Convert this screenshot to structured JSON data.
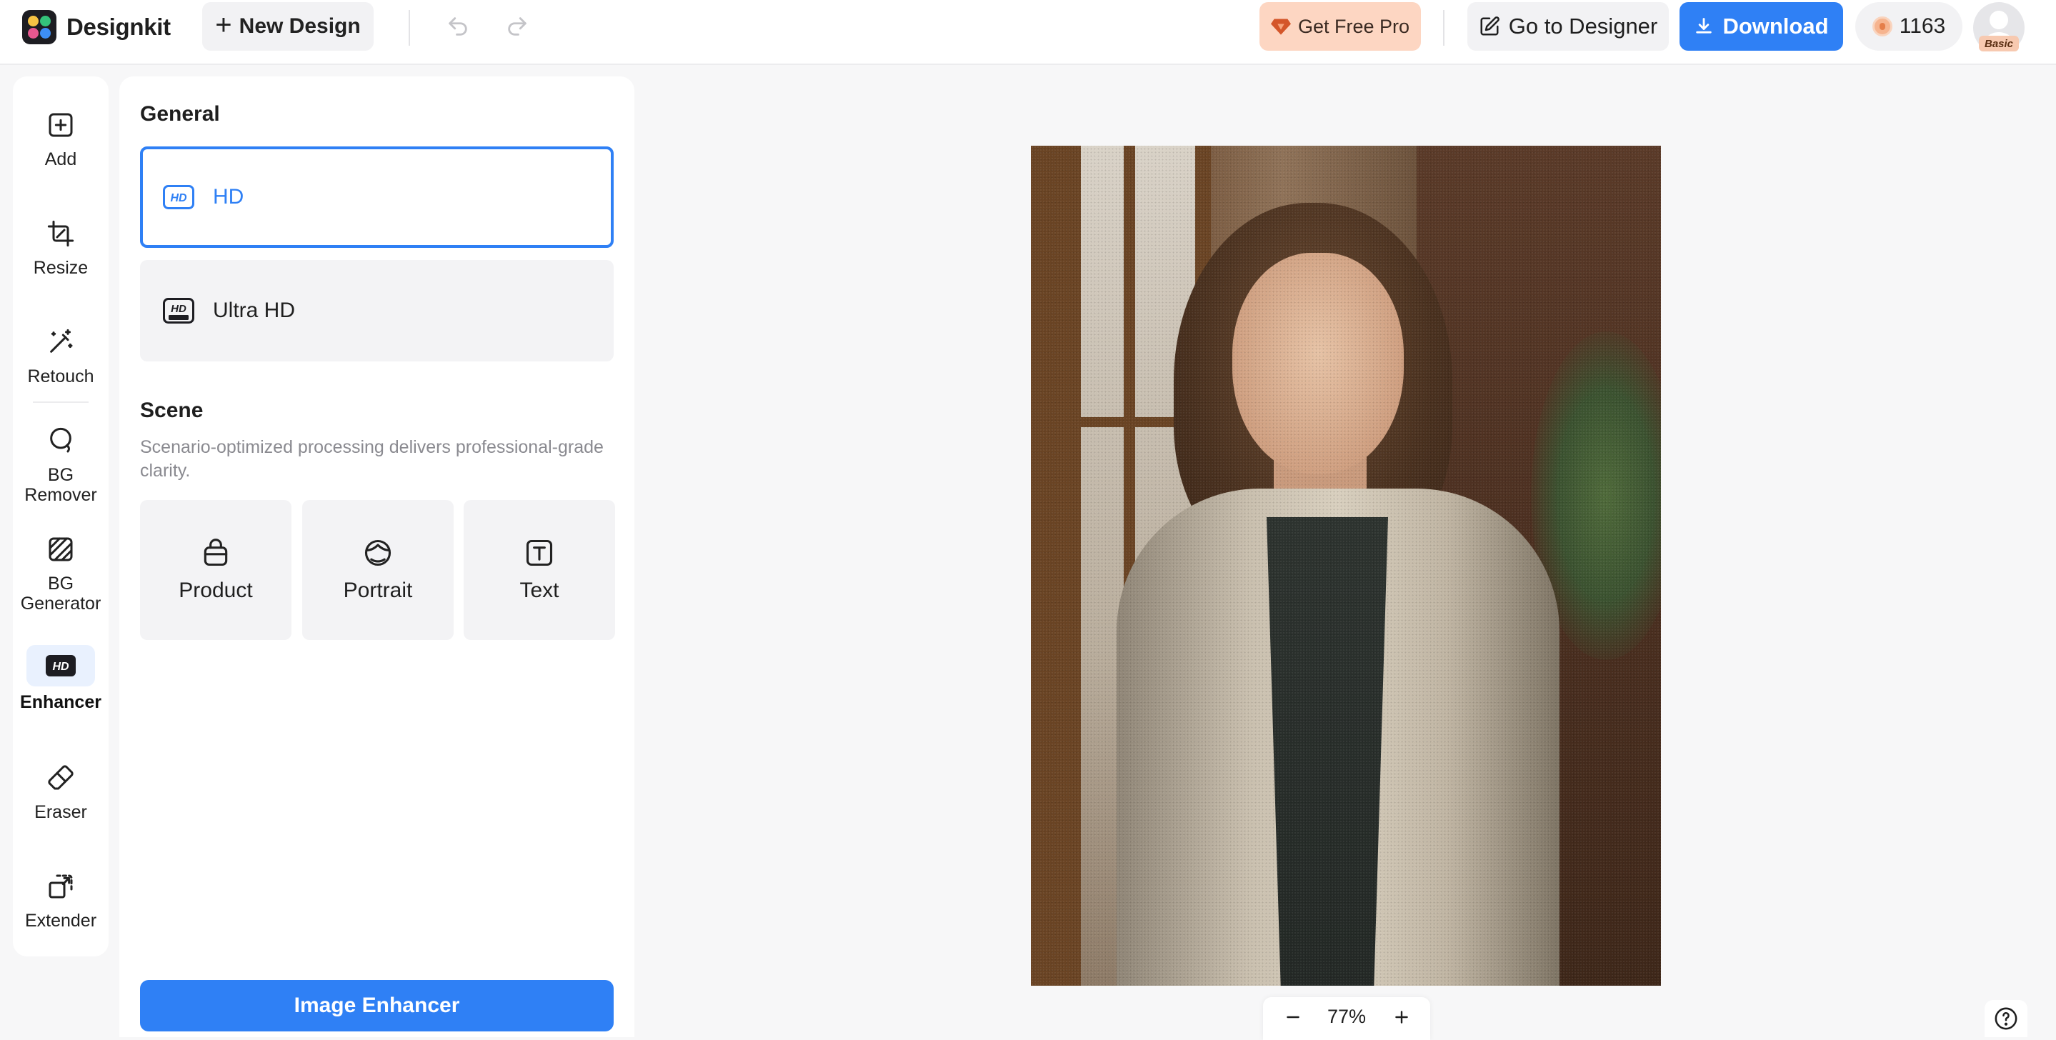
{
  "app": {
    "name": "Designkit"
  },
  "toolbar": {
    "new_design_label": "New Design",
    "get_pro_label": "Get Free Pro",
    "go_to_designer_label": "Go to Designer",
    "download_label": "Download",
    "credits": "1163",
    "plan_badge": "Basic"
  },
  "tools": [
    {
      "label": "Add",
      "icon": "add-square-icon"
    },
    {
      "label": "Resize",
      "icon": "crop-icon"
    },
    {
      "label": "Retouch",
      "icon": "magic-wand-icon"
    },
    {
      "label": "BG\nRemover",
      "icon": "lasso-icon"
    },
    {
      "label": "BG\nGenerator",
      "icon": "hatched-square-icon"
    },
    {
      "label": "Enhancer",
      "icon": "hd-icon",
      "active": true
    },
    {
      "label": "Eraser",
      "icon": "eraser-icon"
    },
    {
      "label": "Extender",
      "icon": "expand-icon"
    }
  ],
  "panel": {
    "general_title": "General",
    "options": [
      {
        "label": "HD",
        "icon": "hd-icon",
        "selected": true
      },
      {
        "label": "Ultra HD",
        "icon": "hd-ultra-icon",
        "selected": false
      }
    ],
    "scene_title": "Scene",
    "scene_description": "Scenario-optimized processing delivers professional-grade clarity.",
    "scenes": [
      {
        "label": "Product",
        "icon": "bag-icon"
      },
      {
        "label": "Portrait",
        "icon": "face-icon"
      },
      {
        "label": "Text",
        "icon": "text-icon"
      }
    ],
    "action_label": "Image Enhancer"
  },
  "canvas": {
    "zoom": "77%"
  },
  "colors": {
    "accent": "#2f80f5",
    "pro_bg": "#fdd6c2",
    "active_tool_bg": "#e9f1fe"
  }
}
